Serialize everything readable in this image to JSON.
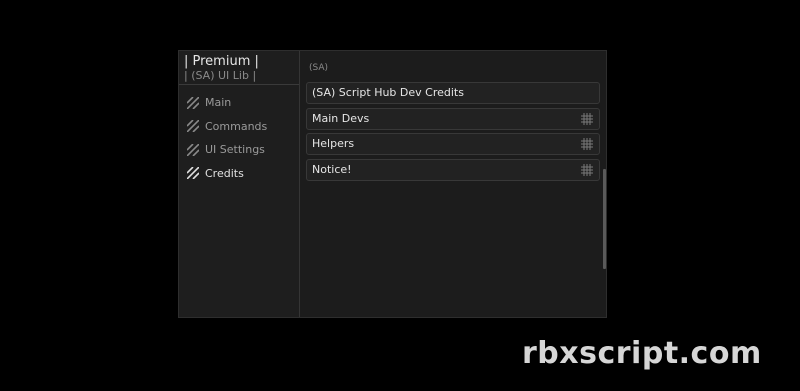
{
  "window": {
    "brand_title": "| Premium |",
    "brand_subtitle": "| (SA) UI Lib |"
  },
  "sidebar": {
    "items": [
      {
        "label": "Main",
        "icon": "striped-tab-icon",
        "active": false
      },
      {
        "label": "Commands",
        "icon": "striped-tab-icon",
        "active": false
      },
      {
        "label": "UI Settings",
        "icon": "striped-tab-icon",
        "active": false
      },
      {
        "label": "Credits",
        "icon": "striped-tab-icon",
        "active": true
      }
    ]
  },
  "content": {
    "section_label": "(SA)",
    "items": [
      {
        "label": "(SA) Script Hub Dev Credits",
        "icon": null
      },
      {
        "label": "Main Devs",
        "icon": "grid-icon"
      },
      {
        "label": "Helpers",
        "icon": "grid-icon"
      },
      {
        "label": "Notice!",
        "icon": "grid-icon"
      }
    ]
  },
  "watermark": {
    "text": "rbxscript.com"
  },
  "colors": {
    "background": "#000000",
    "window": "#1c1c1c",
    "sidebar": "#1e1e1e",
    "item": "#222222",
    "text_active": "#e0e0e0",
    "text_inactive": "#9a9a9a"
  }
}
